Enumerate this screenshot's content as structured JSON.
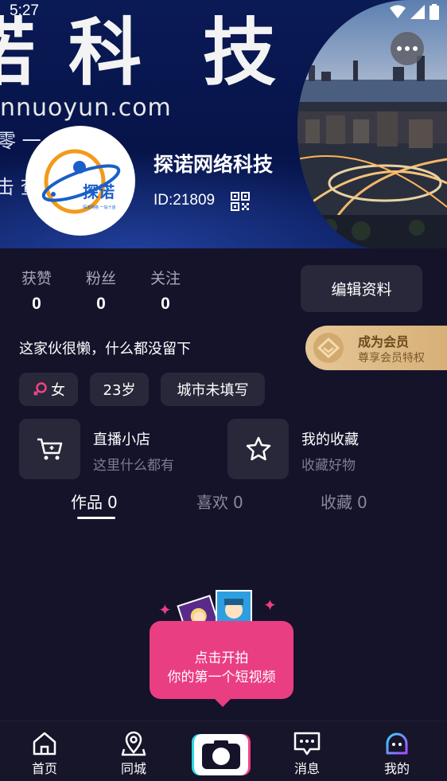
{
  "status_bar": {
    "time": "5:27"
  },
  "banner": {
    "big_text_left": "诺",
    "big_text_mid": "科",
    "big_text_right": "技",
    "url_text": "nnuoyun.com",
    "frag_top": "零 一",
    "frag_bottom": "击 查"
  },
  "profile": {
    "name": "探诺网络科技",
    "id_text": "ID:21809",
    "logo_text": "探诺",
    "logo_tagline": "探诺网络 一站十店"
  },
  "stats": [
    {
      "label": "获赞",
      "value": "0"
    },
    {
      "label": "粉丝",
      "value": "0"
    },
    {
      "label": "关注",
      "value": "0"
    }
  ],
  "edit_button": "编辑资料",
  "bio": "这家伙很懒，什么都没留下",
  "vip": {
    "title": "成为会员",
    "subtitle": "尊享会员特权"
  },
  "tags": {
    "gender": "女",
    "age": "23岁",
    "city": "城市未填写"
  },
  "cards": [
    {
      "title": "直播小店",
      "subtitle": "这里什么都有",
      "icon": "cart-icon"
    },
    {
      "title": "我的收藏",
      "subtitle": "收藏好物",
      "icon": "star-icon"
    }
  ],
  "tabs": [
    {
      "label": "作品",
      "count": "0",
      "active": true
    },
    {
      "label": "喜欢",
      "count": "0",
      "active": false
    },
    {
      "label": "收藏",
      "count": "0",
      "active": false
    }
  ],
  "empty_prompt": {
    "line1": "点击开拍",
    "line2": "你的第一个短视频"
  },
  "bottom_nav": [
    {
      "label": "首页",
      "icon": "home-icon"
    },
    {
      "label": "同城",
      "icon": "location-icon"
    },
    {
      "label": "",
      "icon": "camera-icon"
    },
    {
      "label": "消息",
      "icon": "message-icon"
    },
    {
      "label": "我的",
      "icon": "profile-face-icon"
    }
  ],
  "colors": {
    "background": "#15132a",
    "card": "#29283a",
    "accent_pink": "#ea3e83",
    "vip_gold": "#e6c796"
  }
}
